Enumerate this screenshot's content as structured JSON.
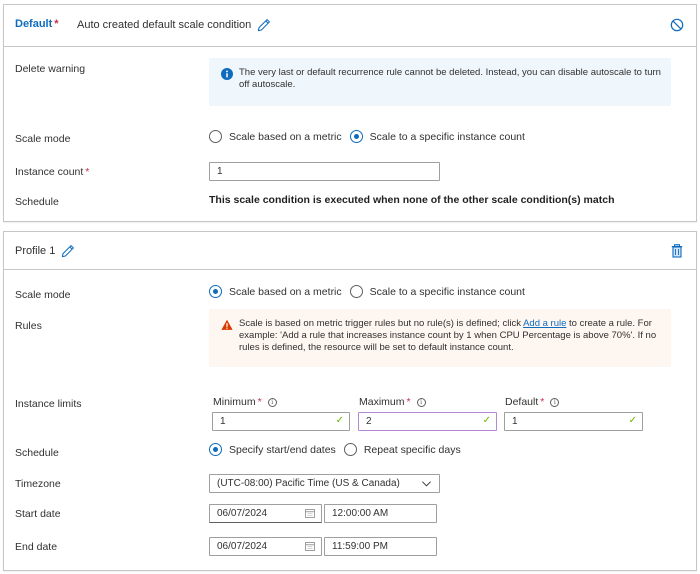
{
  "default_condition": {
    "title": "Default",
    "required_mark": "*",
    "subtitle": "Auto created default scale condition",
    "delete_warning_label": "Delete warning",
    "delete_warning_message": "The very last or default recurrence rule cannot be deleted. Instead, you can disable autoscale to turn off autoscale.",
    "scale_mode_label": "Scale mode",
    "scale_mode_options": [
      "Scale based on a metric",
      "Scale to a specific instance count"
    ],
    "scale_mode_selected": "Scale to a specific instance count",
    "instance_count_label": "Instance count",
    "instance_count_value": "1",
    "schedule_label": "Schedule",
    "schedule_text": "This scale condition is executed when none of the other scale condition(s) match",
    "header_icon": "disable-icon"
  },
  "profile1": {
    "title": "Profile 1",
    "header_icon": "delete-icon",
    "scale_mode_label": "Scale mode",
    "scale_mode_options": [
      "Scale based on a metric",
      "Scale to a specific instance count"
    ],
    "scale_mode_selected": "Scale based on a metric",
    "rules_label": "Rules",
    "rules_warning": {
      "before_link": "Scale is based on metric trigger rules but no rule(s) is defined; click ",
      "link_text": "Add a rule",
      "after_link": " to create a rule. For example: 'Add a rule that increases instance count by 1 when CPU Percentage is above 70%'. If no rules is defined, the resource will be set to default instance count."
    },
    "instance_limits_label": "Instance limits",
    "limits": {
      "minimum": {
        "label": "Minimum",
        "value": "1"
      },
      "maximum": {
        "label": "Maximum",
        "value": "2"
      },
      "default": {
        "label": "Default",
        "value": "1"
      }
    },
    "required_mark": "*",
    "info_glyph": "i",
    "check_glyph": "✓",
    "schedule_label": "Schedule",
    "schedule_options": [
      "Specify start/end dates",
      "Repeat specific days"
    ],
    "schedule_selected": "Specify start/end dates",
    "timezone_label": "Timezone",
    "timezone_value": "(UTC-08:00) Pacific Time (US & Canada)",
    "start_date_label": "Start date",
    "start_date": "06/07/2024",
    "start_time": "12:00:00 AM",
    "end_date_label": "End date",
    "end_date": "06/07/2024",
    "end_time": "11:59:00 PM"
  },
  "colors": {
    "accent": "#0f6cbd",
    "required": "#c4314b",
    "info_bg": "#eff6fc",
    "warning_bg": "#fdf6f1",
    "warning_icon": "#d83b01",
    "success_check": "#6bb700"
  }
}
